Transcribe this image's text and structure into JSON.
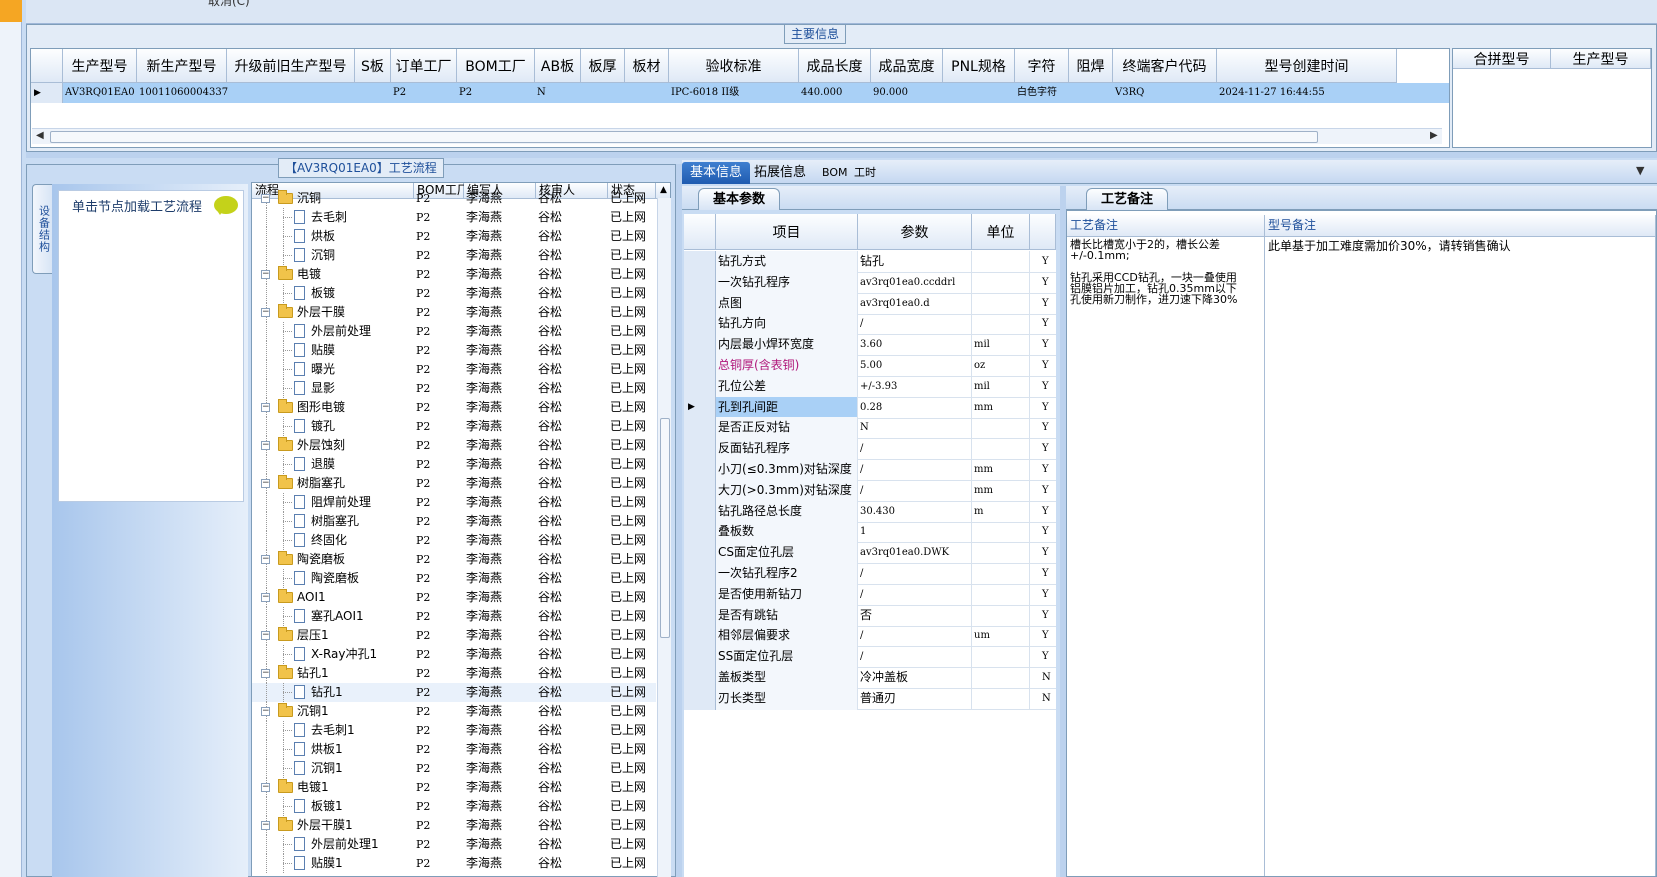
{
  "top": {
    "cut_text": "取消(C)"
  },
  "main_info": {
    "caption": "主要信息",
    "columns": [
      "生产型号",
      "新生产型号",
      "升级前旧生产型号",
      "S板",
      "订单工厂",
      "BOM工厂",
      "AB板",
      "板厚",
      "板材",
      "验收标准",
      "成品长度",
      "成品宽度",
      "PNL规格",
      "字符",
      "阻焊",
      "终端客户代码",
      "型号创建时间"
    ],
    "row": [
      "AV3RQ01EA0",
      "10011060004337",
      "",
      "",
      "P2",
      "P2",
      "N",
      "",
      "",
      "IPC-6018 II级",
      "440.000",
      "90.000",
      "",
      "白色字符",
      "",
      "V3RQ",
      "2024-11-27 16:44:55"
    ],
    "side_columns": [
      "合拼型号",
      "生产型号"
    ]
  },
  "process": {
    "caption": "【AV3RQ01EA0】工艺流程",
    "side_tab_label": "设备结构",
    "load_hint": "单击节点加载工艺流程",
    "columns": [
      "流程",
      "BOM工厂",
      "编写人",
      "核审人",
      "状态"
    ],
    "rows": [
      {
        "name": "沉铜",
        "level": 0,
        "factory": "P2",
        "author": "李海燕",
        "reviewer": "谷松",
        "status": "已上网"
      },
      {
        "name": "去毛刺",
        "level": 1,
        "factory": "P2",
        "author": "李海燕",
        "reviewer": "谷松",
        "status": "已上网"
      },
      {
        "name": "烘板",
        "level": 1,
        "factory": "P2",
        "author": "李海燕",
        "reviewer": "谷松",
        "status": "已上网"
      },
      {
        "name": "沉铜",
        "level": 1,
        "factory": "P2",
        "author": "李海燕",
        "reviewer": "谷松",
        "status": "已上网"
      },
      {
        "name": "电镀",
        "level": 0,
        "factory": "P2",
        "author": "李海燕",
        "reviewer": "谷松",
        "status": "已上网"
      },
      {
        "name": "板镀",
        "level": 1,
        "factory": "P2",
        "author": "李海燕",
        "reviewer": "谷松",
        "status": "已上网"
      },
      {
        "name": "外层干膜",
        "level": 0,
        "factory": "P2",
        "author": "李海燕",
        "reviewer": "谷松",
        "status": "已上网"
      },
      {
        "name": "外层前处理",
        "level": 1,
        "factory": "P2",
        "author": "李海燕",
        "reviewer": "谷松",
        "status": "已上网"
      },
      {
        "name": "贴膜",
        "level": 1,
        "factory": "P2",
        "author": "李海燕",
        "reviewer": "谷松",
        "status": "已上网"
      },
      {
        "name": "曝光",
        "level": 1,
        "factory": "P2",
        "author": "李海燕",
        "reviewer": "谷松",
        "status": "已上网"
      },
      {
        "name": "显影",
        "level": 1,
        "factory": "P2",
        "author": "李海燕",
        "reviewer": "谷松",
        "status": "已上网"
      },
      {
        "name": "图形电镀",
        "level": 0,
        "factory": "P2",
        "author": "李海燕",
        "reviewer": "谷松",
        "status": "已上网"
      },
      {
        "name": "镀孔",
        "level": 1,
        "factory": "P2",
        "author": "李海燕",
        "reviewer": "谷松",
        "status": "已上网"
      },
      {
        "name": "外层蚀刻",
        "level": 0,
        "factory": "P2",
        "author": "李海燕",
        "reviewer": "谷松",
        "status": "已上网"
      },
      {
        "name": "退膜",
        "level": 1,
        "factory": "P2",
        "author": "李海燕",
        "reviewer": "谷松",
        "status": "已上网"
      },
      {
        "name": "树脂塞孔",
        "level": 0,
        "factory": "P2",
        "author": "李海燕",
        "reviewer": "谷松",
        "status": "已上网"
      },
      {
        "name": "阻焊前处理",
        "level": 1,
        "factory": "P2",
        "author": "李海燕",
        "reviewer": "谷松",
        "status": "已上网"
      },
      {
        "name": "树脂塞孔",
        "level": 1,
        "factory": "P2",
        "author": "李海燕",
        "reviewer": "谷松",
        "status": "已上网"
      },
      {
        "name": "终固化",
        "level": 1,
        "factory": "P2",
        "author": "李海燕",
        "reviewer": "谷松",
        "status": "已上网"
      },
      {
        "name": "陶瓷磨板",
        "level": 0,
        "factory": "P2",
        "author": "李海燕",
        "reviewer": "谷松",
        "status": "已上网"
      },
      {
        "name": "陶瓷磨板",
        "level": 1,
        "factory": "P2",
        "author": "李海燕",
        "reviewer": "谷松",
        "status": "已上网"
      },
      {
        "name": "AOI1",
        "level": 0,
        "factory": "P2",
        "author": "李海燕",
        "reviewer": "谷松",
        "status": "已上网"
      },
      {
        "name": "塞孔AOI1",
        "level": 1,
        "factory": "P2",
        "author": "李海燕",
        "reviewer": "谷松",
        "status": "已上网"
      },
      {
        "name": "层压1",
        "level": 0,
        "factory": "P2",
        "author": "李海燕",
        "reviewer": "谷松",
        "status": "已上网"
      },
      {
        "name": "X-Ray冲孔1",
        "level": 1,
        "factory": "P2",
        "author": "李海燕",
        "reviewer": "谷松",
        "status": "已上网"
      },
      {
        "name": "钻孔1",
        "level": 0,
        "factory": "P2",
        "author": "李海燕",
        "reviewer": "谷松",
        "status": "已上网"
      },
      {
        "name": "钻孔1",
        "level": 1,
        "factory": "P2",
        "author": "李海燕",
        "reviewer": "谷松",
        "status": "已上网",
        "selected": true
      },
      {
        "name": "沉铜1",
        "level": 0,
        "factory": "P2",
        "author": "李海燕",
        "reviewer": "谷松",
        "status": "已上网"
      },
      {
        "name": "去毛刺1",
        "level": 1,
        "factory": "P2",
        "author": "李海燕",
        "reviewer": "谷松",
        "status": "已上网"
      },
      {
        "name": "烘板1",
        "level": 1,
        "factory": "P2",
        "author": "李海燕",
        "reviewer": "谷松",
        "status": "已上网"
      },
      {
        "name": "沉铜1",
        "level": 1,
        "factory": "P2",
        "author": "李海燕",
        "reviewer": "谷松",
        "status": "已上网"
      },
      {
        "name": "电镀1",
        "level": 0,
        "factory": "P2",
        "author": "李海燕",
        "reviewer": "谷松",
        "status": "已上网"
      },
      {
        "name": "板镀1",
        "level": 1,
        "factory": "P2",
        "author": "李海燕",
        "reviewer": "谷松",
        "status": "已上网"
      },
      {
        "name": "外层干膜1",
        "level": 0,
        "factory": "P2",
        "author": "李海燕",
        "reviewer": "谷松",
        "status": "已上网"
      },
      {
        "name": "外层前处理1",
        "level": 1,
        "factory": "P2",
        "author": "李海燕",
        "reviewer": "谷松",
        "status": "已上网"
      },
      {
        "name": "贴膜1",
        "level": 1,
        "factory": "P2",
        "author": "李海燕",
        "reviewer": "谷松",
        "status": "已上网"
      }
    ]
  },
  "tabs": [
    "基本信息",
    "拓展信息",
    "BOM",
    "工时"
  ],
  "basic": {
    "sub_tab": "基本参数",
    "columns": [
      "项目",
      "参数",
      "单位"
    ],
    "rows": [
      {
        "item": "钻孔方式",
        "value": "钻孔",
        "unit": "",
        "flag": "Y"
      },
      {
        "item": "一次钻孔程序",
        "value": "av3rq01ea0.ccddrl",
        "unit": "",
        "flag": "Y"
      },
      {
        "item": "点图",
        "value": "av3rq01ea0.d",
        "unit": "",
        "flag": "Y"
      },
      {
        "item": "钻孔方向",
        "value": "/",
        "unit": "",
        "flag": "Y"
      },
      {
        "item": "内层最小焊环宽度",
        "value": "3.60",
        "unit": "mil",
        "flag": "Y"
      },
      {
        "item": "总铜厚(含表铜)",
        "value": "5.00",
        "unit": "oz",
        "flag": "Y",
        "highlight": true
      },
      {
        "item": "孔位公差",
        "value": "+/-3.93",
        "unit": "mil",
        "flag": "Y"
      },
      {
        "item": "孔到孔间距",
        "value": "0.28",
        "unit": "mm",
        "flag": "Y",
        "current": true
      },
      {
        "item": "是否正反对钻",
        "value": "N",
        "unit": "",
        "flag": "Y"
      },
      {
        "item": "反面钻孔程序",
        "value": "/",
        "unit": "",
        "flag": "Y"
      },
      {
        "item": "小刀(≤0.3mm)对钻深度",
        "value": "/",
        "unit": "mm",
        "flag": "Y"
      },
      {
        "item": "大刀(>0.3mm)对钻深度",
        "value": "/",
        "unit": "mm",
        "flag": "Y"
      },
      {
        "item": "钻孔路径总长度",
        "value": "30.430",
        "unit": "m",
        "flag": "Y"
      },
      {
        "item": "叠板数",
        "value": "1",
        "unit": "",
        "flag": "Y"
      },
      {
        "item": "CS面定位孔层",
        "value": "av3rq01ea0.DWK",
        "unit": "",
        "flag": "Y"
      },
      {
        "item": "一次钻孔程序2",
        "value": "/",
        "unit": "",
        "flag": "Y"
      },
      {
        "item": "是否使用新钻刀",
        "value": "/",
        "unit": "",
        "flag": "Y"
      },
      {
        "item": "是否有跳钻",
        "value": "否",
        "unit": "",
        "flag": "Y"
      },
      {
        "item": "相邻层偏要求",
        "value": "/",
        "unit": "um",
        "flag": "Y"
      },
      {
        "item": "SS面定位孔层",
        "value": "/",
        "unit": "",
        "flag": "Y"
      },
      {
        "item": "盖板类型",
        "value": "冷冲盖板",
        "unit": "",
        "flag": "N"
      },
      {
        "item": "刃长类型",
        "value": "普通刃",
        "unit": "",
        "flag": "N"
      }
    ]
  },
  "remarks": {
    "sub_tab": "工艺备注",
    "process_header": "工艺备注",
    "model_header": "型号备注",
    "process_text": "槽长比槽宽小于2的，槽长公差\n+/-0.1mm;\n\n钻孔采用CCD钻孔，一块一叠使用\n铝膜铝片加工，钻孔0.35mm以下\n孔使用新刀制作，进刀速下降30%",
    "model_text": "此单基于加工难度需加价30%，请转销售确认"
  },
  "colors": {
    "accent": "#1f5bb0",
    "highlight_text": "#b0177a",
    "selected_row": "#a9d0f6"
  }
}
